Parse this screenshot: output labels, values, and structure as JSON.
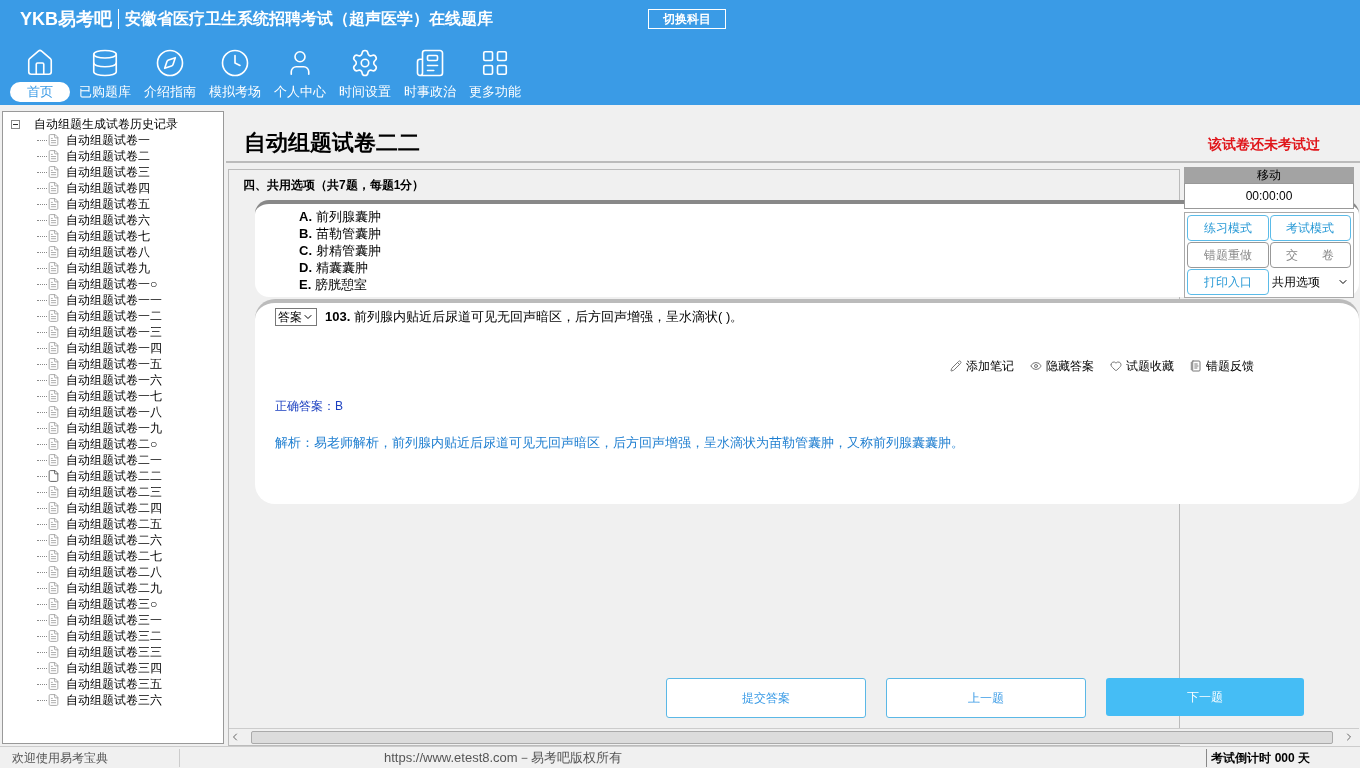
{
  "header": {
    "logo": "YKB易考吧",
    "title": "安徽省医疗卫生系统招聘考试（超声医学）在线题库",
    "switch_button": "切换科目"
  },
  "nav": [
    {
      "label": "首页",
      "selected": true
    },
    {
      "label": "已购题库",
      "selected": false
    },
    {
      "label": "介绍指南",
      "selected": false
    },
    {
      "label": "模拟考场",
      "selected": false
    },
    {
      "label": "个人中心",
      "selected": false
    },
    {
      "label": "时间设置",
      "selected": false
    },
    {
      "label": "时事政治",
      "selected": false
    },
    {
      "label": "更多功能",
      "selected": false
    }
  ],
  "tree": {
    "root": "自动组题生成试卷历史记录",
    "expanded": true,
    "children": [
      {
        "label": "自动组题试卷一",
        "selected": false
      },
      {
        "label": "自动组题试卷二",
        "selected": false
      },
      {
        "label": "自动组题试卷三",
        "selected": false
      },
      {
        "label": "自动组题试卷四",
        "selected": false
      },
      {
        "label": "自动组题试卷五",
        "selected": false
      },
      {
        "label": "自动组题试卷六",
        "selected": false
      },
      {
        "label": "自动组题试卷七",
        "selected": false
      },
      {
        "label": "自动组题试卷八",
        "selected": false
      },
      {
        "label": "自动组题试卷九",
        "selected": false
      },
      {
        "label": "自动组题试卷一○",
        "selected": false
      },
      {
        "label": "自动组题试卷一一",
        "selected": false
      },
      {
        "label": "自动组题试卷一二",
        "selected": false
      },
      {
        "label": "自动组题试卷一三",
        "selected": false
      },
      {
        "label": "自动组题试卷一四",
        "selected": false
      },
      {
        "label": "自动组题试卷一五",
        "selected": false
      },
      {
        "label": "自动组题试卷一六",
        "selected": false
      },
      {
        "label": "自动组题试卷一七",
        "selected": false
      },
      {
        "label": "自动组题试卷一八",
        "selected": false
      },
      {
        "label": "自动组题试卷一九",
        "selected": false
      },
      {
        "label": "自动组题试卷二○",
        "selected": false
      },
      {
        "label": "自动组题试卷二一",
        "selected": false
      },
      {
        "label": "自动组题试卷二二",
        "selected": true
      },
      {
        "label": "自动组题试卷二三",
        "selected": false
      },
      {
        "label": "自动组题试卷二四",
        "selected": false
      },
      {
        "label": "自动组题试卷二五",
        "selected": false
      },
      {
        "label": "自动组题试卷二六",
        "selected": false
      },
      {
        "label": "自动组题试卷二七",
        "selected": false
      },
      {
        "label": "自动组题试卷二八",
        "selected": false
      },
      {
        "label": "自动组题试卷二九",
        "selected": false
      },
      {
        "label": "自动组题试卷三○",
        "selected": false
      },
      {
        "label": "自动组题试卷三一",
        "selected": false
      },
      {
        "label": "自动组题试卷三二",
        "selected": false
      },
      {
        "label": "自动组题试卷三三",
        "selected": false
      },
      {
        "label": "自动组题试卷三四",
        "selected": false
      },
      {
        "label": "自动组题试卷三五",
        "selected": false
      },
      {
        "label": "自动组题试卷三六",
        "selected": false
      }
    ]
  },
  "paper": {
    "title": "自动组题试卷二二",
    "status": "该试卷还未考试过",
    "section": "四、共用选项（共7题，每题1分）",
    "options": [
      {
        "letter": "A.",
        "text": "前列腺囊肿"
      },
      {
        "letter": "B.",
        "text": "苗勒管囊肿"
      },
      {
        "letter": "C.",
        "text": "射精管囊肿"
      },
      {
        "letter": "D.",
        "text": "精囊囊肿"
      },
      {
        "letter": "E.",
        "text": "膀胱憩室"
      }
    ],
    "question": {
      "answer_select": "答案",
      "number": "103.",
      "text": "前列腺内贴近后尿道可见无回声暗区，后方回声增强，呈水滴状( )。"
    },
    "actions": [
      {
        "label": "添加笔记"
      },
      {
        "label": "隐藏答案"
      },
      {
        "label": "试题收藏"
      },
      {
        "label": "错题反馈"
      }
    ],
    "correct_answer": "正确答案：B",
    "explanation": "解析：易老师解析，前列腺内贴近后尿道可见无回声暗区，后方回声增强，呈水滴状为苗勒管囊肿，又称前列腺囊囊肿。",
    "buttons": [
      {
        "label": "提交答案",
        "primary": false
      },
      {
        "label": "上一题",
        "primary": false
      },
      {
        "label": "下一题",
        "primary": true
      }
    ]
  },
  "panel": {
    "title": "移动",
    "timer": "00:00:00",
    "buttons": [
      {
        "label": "练习模式",
        "disabled": false
      },
      {
        "label": "考试模式",
        "disabled": false
      },
      {
        "label": "错题重做",
        "disabled": true
      },
      {
        "label": "交　　卷",
        "disabled": true
      },
      {
        "label": "打印入口",
        "disabled": false
      }
    ],
    "select": "共用选项"
  },
  "status_bar": {
    "welcome": "欢迎使用易考宝典",
    "copyright": "https://www.etest8.com－易考吧版权所有",
    "countdown": "考试倒计时 000 天"
  }
}
